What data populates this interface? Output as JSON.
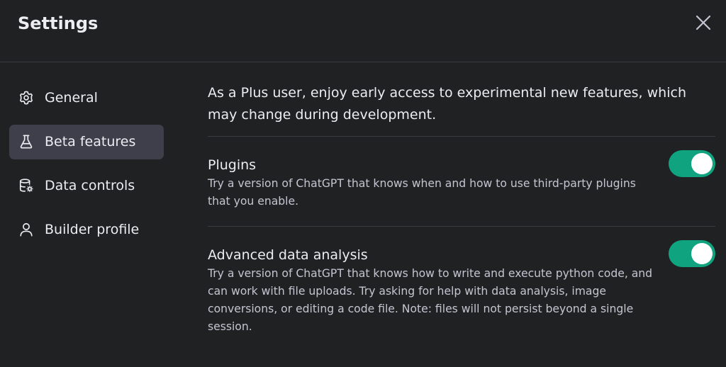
{
  "header": {
    "title": "Settings"
  },
  "sidebar": {
    "items": [
      {
        "label": "General",
        "icon": "gear-icon",
        "active": false
      },
      {
        "label": "Beta features",
        "icon": "flask-icon",
        "active": true
      },
      {
        "label": "Data controls",
        "icon": "database-gear-icon",
        "active": false
      },
      {
        "label": "Builder profile",
        "icon": "person-icon",
        "active": false
      }
    ]
  },
  "main": {
    "intro": "As a Plus user, enjoy early access to experimental new features, which may change during development.",
    "features": [
      {
        "title": "Plugins",
        "description": "Try a version of ChatGPT that knows when and how to use third-party plugins that you enable.",
        "enabled": true
      },
      {
        "title": "Advanced data analysis",
        "description": "Try a version of ChatGPT that knows how to write and execute python code, and can work with file uploads. Try asking for help with data analysis, image conversions, or editing a code file. Note: files will not persist beyond a single session.",
        "enabled": true
      }
    ]
  },
  "colors": {
    "background": "#202123",
    "active_nav": "#3e3f4b",
    "toggle_on": "#10a37f",
    "divider": "#3a3b40"
  }
}
